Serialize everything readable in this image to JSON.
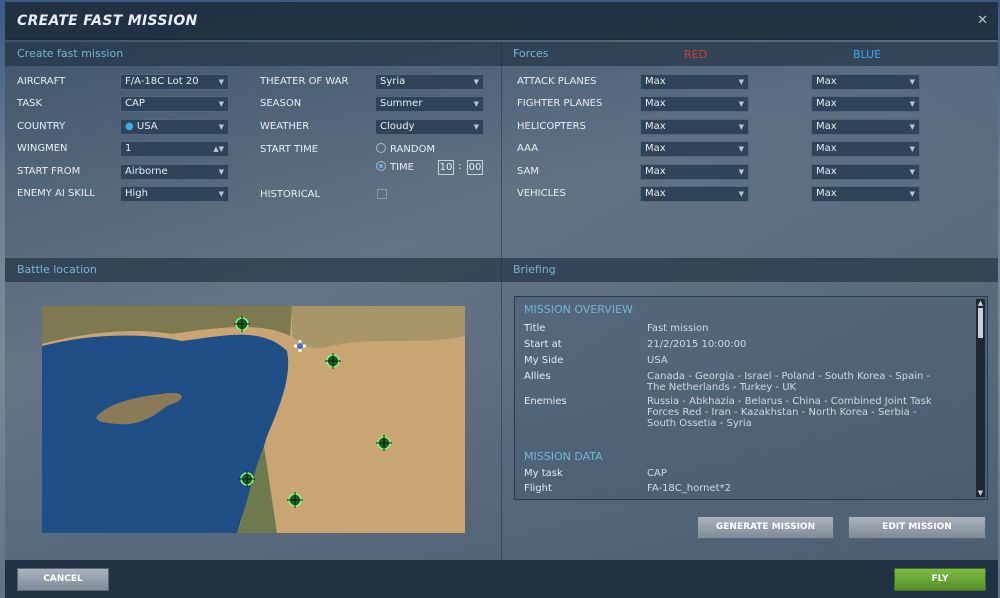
{
  "window": {
    "title": "CREATE FAST MISSION",
    "close_icon": "close-icon"
  },
  "create": {
    "header": "Create fast mission",
    "left": [
      {
        "label": "AIRCRAFT",
        "value": "F/A-18C Lot 20"
      },
      {
        "label": "TASK",
        "value": "CAP"
      },
      {
        "label": "COUNTRY",
        "value": "USA"
      },
      {
        "label": "WINGMEN",
        "value": "1"
      },
      {
        "label": "START FROM",
        "value": "Airborne"
      },
      {
        "label": "ENEMY AI SKILL",
        "value": "High"
      }
    ],
    "mid": [
      {
        "label": "THEATER OF WAR",
        "value": "Syria"
      },
      {
        "label": "SEASON",
        "value": "Summer"
      },
      {
        "label": "WEATHER",
        "value": "Cloudy"
      }
    ],
    "start_time": {
      "label": "START TIME",
      "random": "RANDOM",
      "time": "TIME",
      "hours": "10",
      "sep": ":",
      "minutes": "00",
      "selected": "TIME"
    },
    "historical": {
      "label": "HISTORICAL",
      "checked": false
    }
  },
  "forces": {
    "header": "Forces",
    "red": "RED",
    "blue": "BLUE",
    "red_color": "#d23c3c",
    "blue_color": "#3ca8e8",
    "rows": [
      {
        "label": "ATTACK PLANES",
        "red": "Max",
        "blue": "Max"
      },
      {
        "label": "FIGHTER PLANES",
        "red": "Max",
        "blue": "Max"
      },
      {
        "label": "HELICOPTERS",
        "red": "Max",
        "blue": "Max"
      },
      {
        "label": "AAA",
        "red": "Max",
        "blue": "Max"
      },
      {
        "label": "SAM",
        "red": "Max",
        "blue": "Max"
      },
      {
        "label": "VEHICLES",
        "red": "Max",
        "blue": "Max"
      }
    ]
  },
  "battle": {
    "header": "Battle location"
  },
  "briefing": {
    "header": "Briefing",
    "overview": "MISSION OVERVIEW",
    "rows": [
      {
        "k": "Title",
        "v": "Fast mission"
      },
      {
        "k": "Start at",
        "v": "21/2/2015  10:00:00"
      },
      {
        "k": "My Side",
        "v": "USA"
      },
      {
        "k": "Allies",
        "v": "Canada - Georgia - Israel - Poland - South Korea - Spain - The Netherlands - Turkey - UK"
      },
      {
        "k": "Enemies",
        "v": "Russia - Abkhazia - Belarus - China - Combined Joint Task Forces Red - Iran - Kazakhstan - North Korea - Serbia - South Ossetia - Syria"
      }
    ],
    "data_header": "MISSION DATA",
    "data_rows": [
      {
        "k": "My task",
        "v": "CAP"
      },
      {
        "k": "Flight",
        "v": "FA-18C_hornet*2"
      }
    ]
  },
  "buttons": {
    "generate": "GENERATE MISSION",
    "edit": "EDIT MISSION",
    "cancel": "CANCEL",
    "fly": "FLY",
    "fly_color": "#6aa33a"
  }
}
